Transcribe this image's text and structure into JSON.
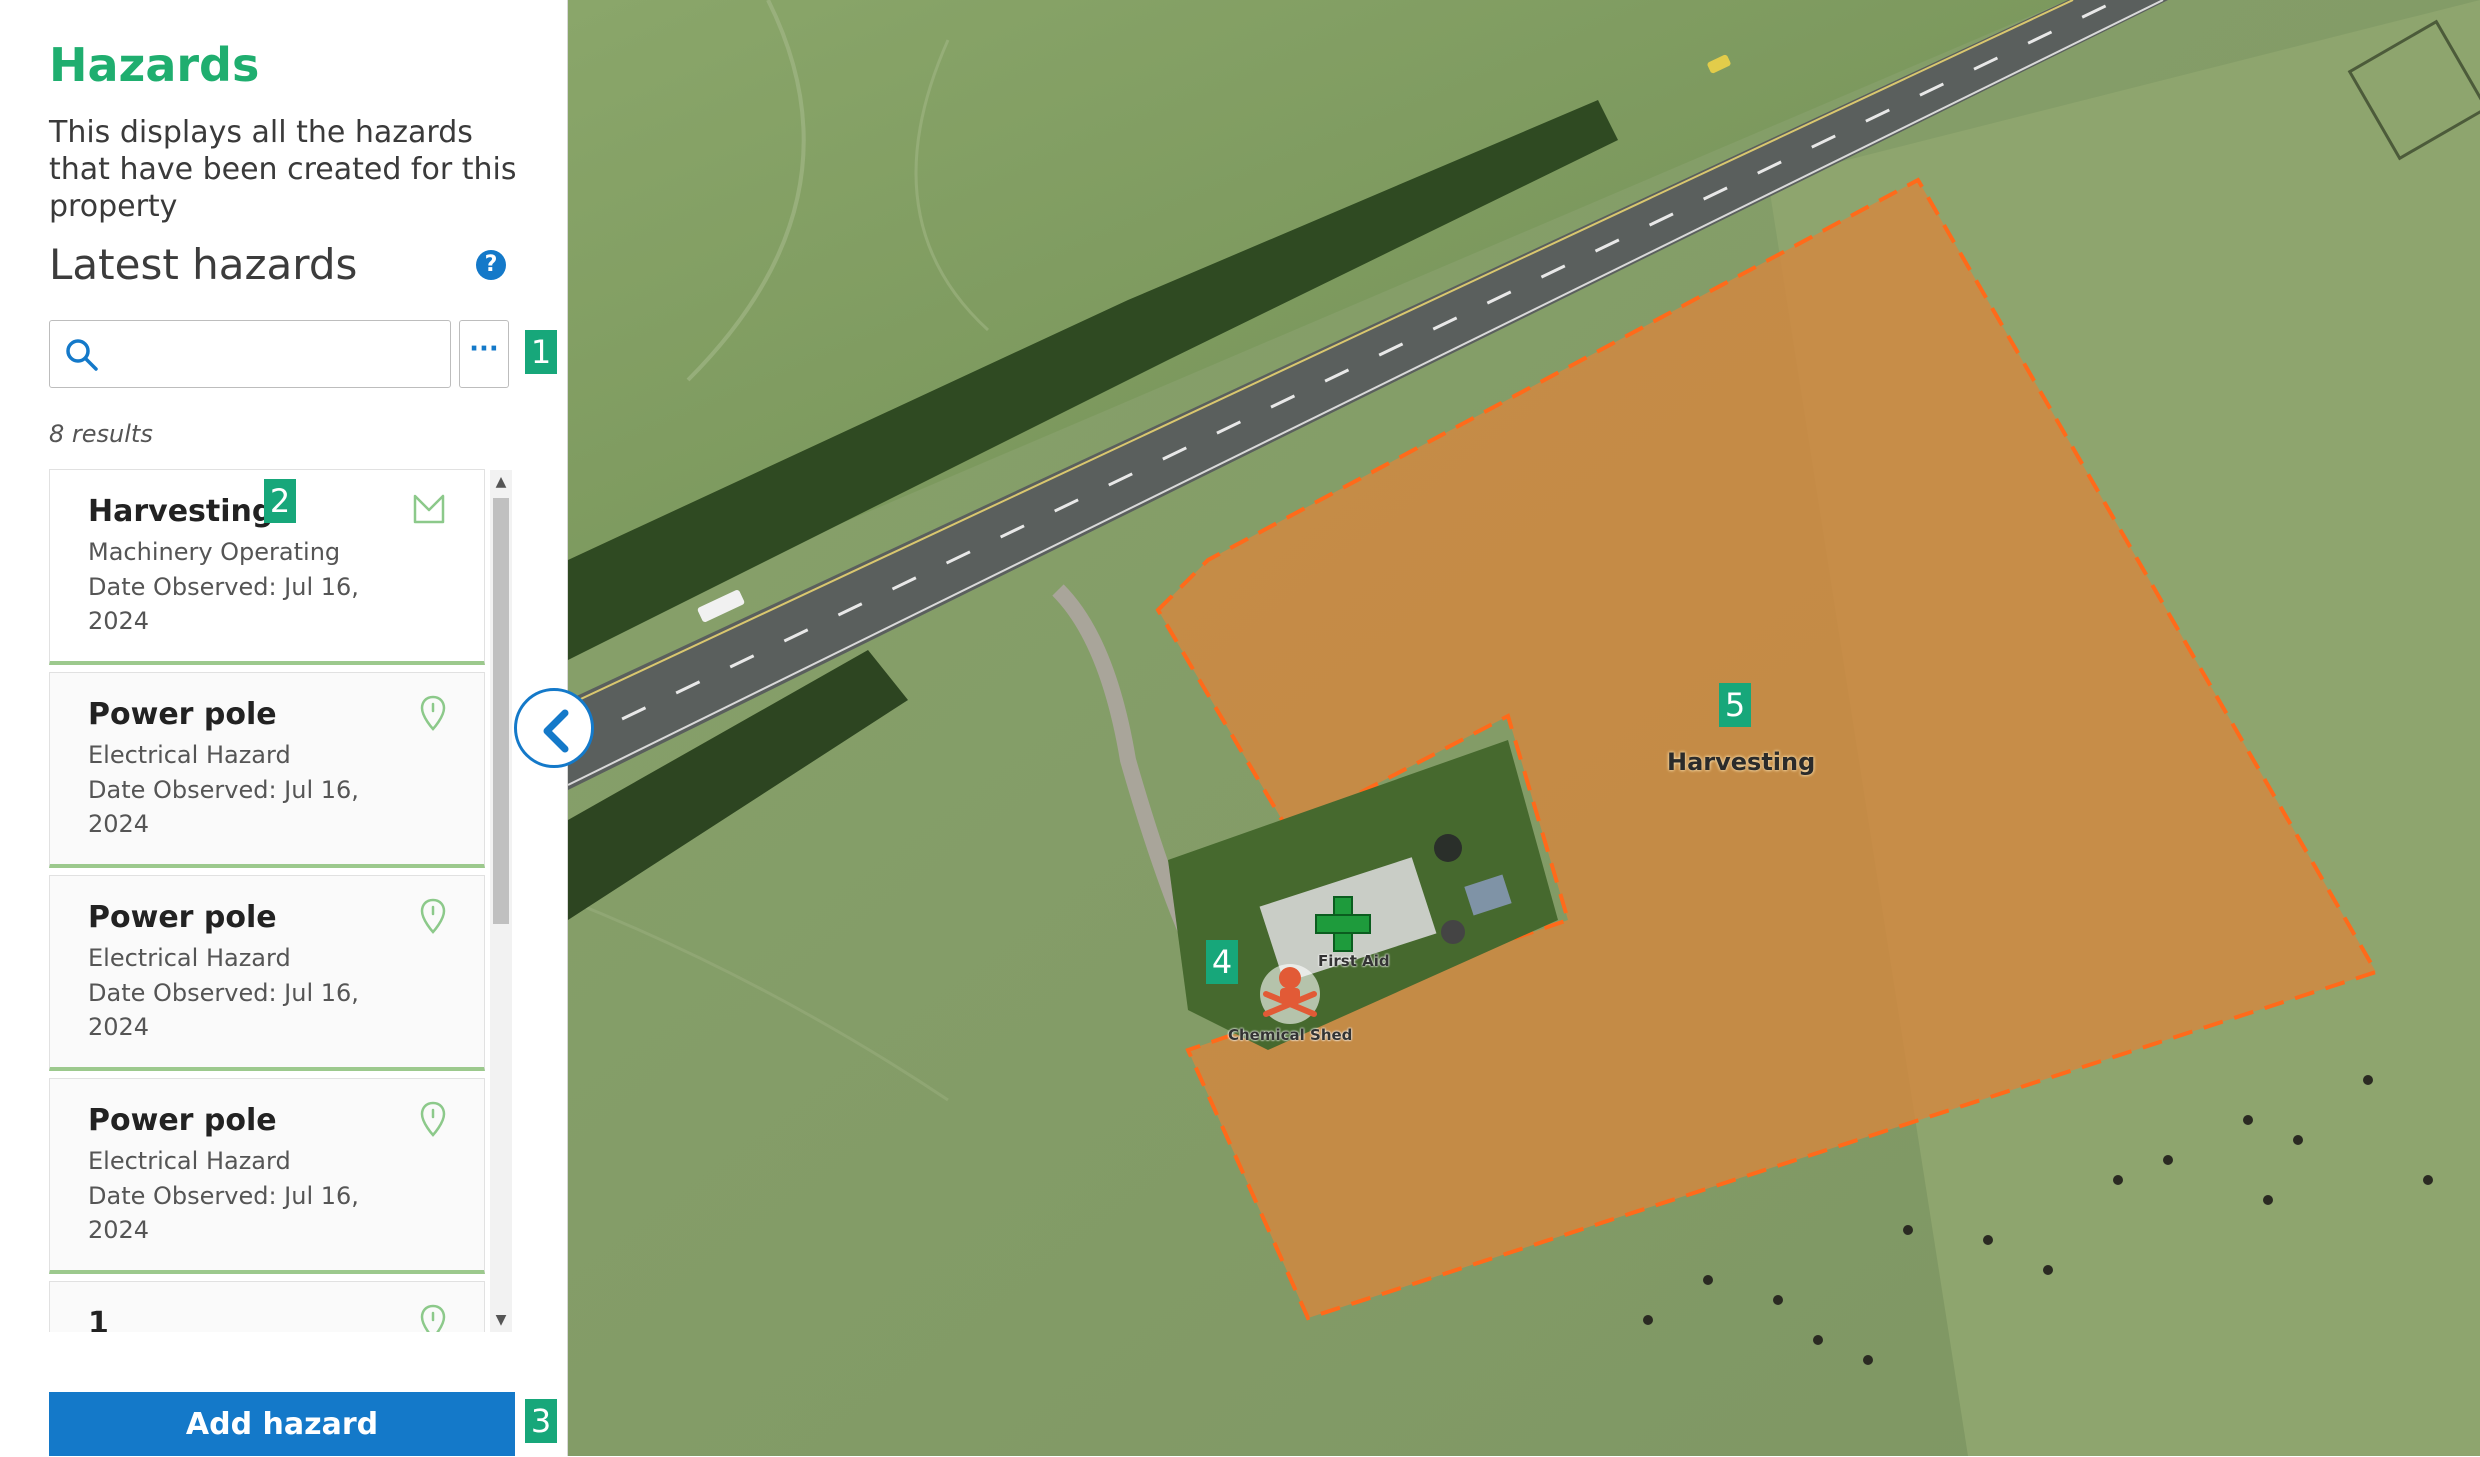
{
  "sidebar": {
    "title": "Hazards",
    "description": "This displays all the hazards that have been created for this property",
    "latest_heading": "Latest hazards",
    "help_icon": "?",
    "search": {
      "placeholder": "",
      "value": ""
    },
    "more_label": "···",
    "results_text": "8 results",
    "add_button_label": "Add hazard"
  },
  "hazards": [
    {
      "name": "Harvesting",
      "type": "Machinery Operating",
      "date": "Date Observed: Jul 16, 2024",
      "icon": "area-icon"
    },
    {
      "name": "Power pole",
      "type": "Electrical Hazard",
      "date": "Date Observed: Jul 16, 2024",
      "icon": "pin-icon"
    },
    {
      "name": "Power pole",
      "type": "Electrical Hazard",
      "date": "Date Observed: Jul 16, 2024",
      "icon": "pin-icon"
    },
    {
      "name": "Power pole",
      "type": "Electrical Hazard",
      "date": "Date Observed: Jul 16, 2024",
      "icon": "pin-icon"
    },
    {
      "name": "1",
      "type": "",
      "date": "",
      "icon": "pin-icon"
    }
  ],
  "map": {
    "area_label": "Harvesting",
    "first_aid_label": "First Aid",
    "chemical_label": "Chemical Shed",
    "colors": {
      "area_fill": "#d7863e",
      "area_border": "#ff6a1a",
      "first_aid": "#1e9b3c",
      "chemical": "#e25a36"
    }
  },
  "annotations": [
    "1",
    "2",
    "3",
    "4",
    "5"
  ],
  "colors": {
    "brand_green": "#1fae6f",
    "primary_blue": "#1479c9",
    "card_border": "#9cc98d"
  }
}
